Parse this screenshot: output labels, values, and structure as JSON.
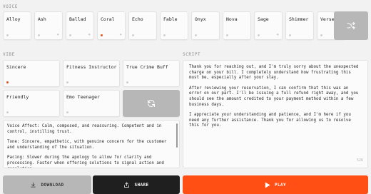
{
  "voice": {
    "label": "VOICE",
    "items": [
      {
        "name": "Alloy",
        "active": false,
        "sparkle": false
      },
      {
        "name": "Ash",
        "active": false,
        "sparkle": true
      },
      {
        "name": "Ballad",
        "active": false,
        "sparkle": true
      },
      {
        "name": "Coral",
        "active": true,
        "sparkle": true
      },
      {
        "name": "Echo",
        "active": false,
        "sparkle": false
      },
      {
        "name": "Fable",
        "active": false,
        "sparkle": false
      },
      {
        "name": "Onyx",
        "active": false,
        "sparkle": false
      },
      {
        "name": "Nova",
        "active": false,
        "sparkle": false
      },
      {
        "name": "Sage",
        "active": false,
        "sparkle": true
      },
      {
        "name": "Shimmer",
        "active": false,
        "sparkle": false
      },
      {
        "name": "Verse",
        "active": false,
        "sparkle": true
      }
    ],
    "shuffle_icon": "shuffle-icon"
  },
  "vibe": {
    "label": "VIBE",
    "items": [
      {
        "name": "Sincere",
        "active": true
      },
      {
        "name": "Fitness Instructor",
        "active": false
      },
      {
        "name": "True Crime Buff",
        "active": false
      },
      {
        "name": "Friendly",
        "active": false
      },
      {
        "name": "Emo Teenager",
        "active": false
      }
    ],
    "refresh_icon": "refresh-icon",
    "description": [
      "Voice Affect: Calm, composed, and reassuring. Competent and in control, instilling trust.",
      "Tone: Sincere, empathetic, with genuine concern for the customer and understanding of the situation.",
      "Pacing: Slower during the apology to allow for clarity and processing. Faster when offering solutions to signal action and resolution."
    ]
  },
  "script": {
    "label": "SCRIPT",
    "paragraphs": [
      "Thank you for reaching out, and I'm truly sorry about the unexpected charge on your bill. I completely understand how frustrating this must be, especially after your stay.",
      "After reviewing your reservation, I can confirm that this was an error on our part. I'll be issuing a full refund right away, and you should see the amount credited to your payment method within a few business days.",
      "I appreciate your understanding and patience, and I'm here if you need any further assistance. Thank you for allowing us to resolve this for you."
    ],
    "char_count": "526"
  },
  "actions": {
    "download_label": "DOWNLOAD",
    "share_label": "SHARE",
    "play_label": "PLAY"
  },
  "colors": {
    "accent": "#ff4f14",
    "active_dot": "#e2571f",
    "dark": "#1f1f1f",
    "muted_button": "#b7b7b7"
  }
}
